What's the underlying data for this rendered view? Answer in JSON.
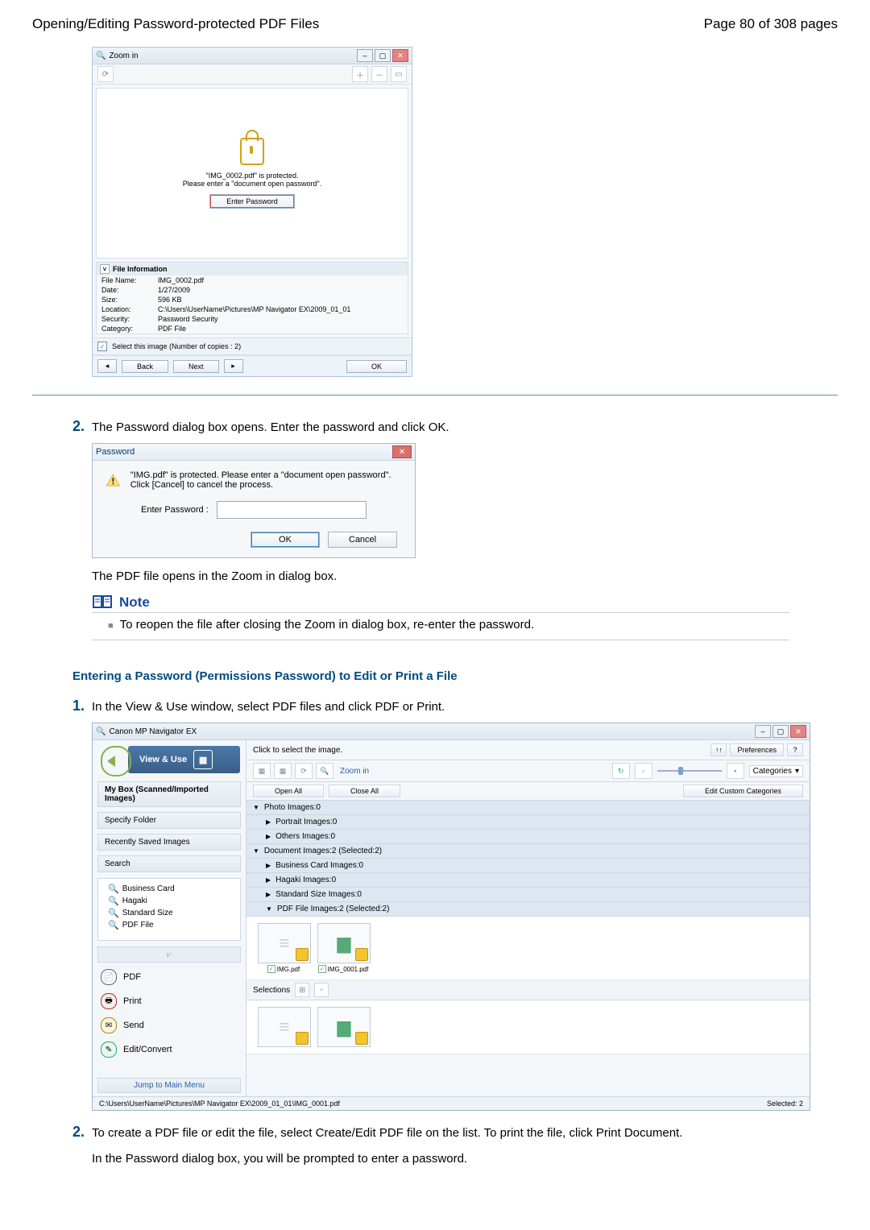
{
  "header": {
    "title": "Opening/Editing Password-protected PDF Files",
    "page_of": "Page 80 of 308 pages"
  },
  "zoom_window": {
    "title": "Zoom in",
    "protected_line1": "\"IMG_0002.pdf\" is protected.",
    "protected_line2": "Please enter a \"document open password\".",
    "enter_password_btn": "Enter Password",
    "file_info_title": "File Information",
    "rows": {
      "file_name_l": "File Name:",
      "file_name_v": "IMG_0002.pdf",
      "date_l": "Date:",
      "date_v": "1/27/2009",
      "size_l": "Size:",
      "size_v": "596 KB",
      "location_l": "Location:",
      "location_v": "C:\\Users\\UserName\\Pictures\\MP Navigator EX\\2009_01_01",
      "security_l": "Security:",
      "security_v": "Password Security",
      "category_l": "Category:",
      "category_v": "PDF File"
    },
    "select_image": "Select this image (Number of copies : 2)",
    "back": "Back",
    "next": "Next",
    "ok": "OK"
  },
  "step2a": {
    "num": "2.",
    "text": "The Password dialog box opens. Enter the password and click OK."
  },
  "pw_dialog": {
    "title": "Password",
    "msg": "\"IMG.pdf\" is protected. Please enter a \"document open password\". Click [Cancel] to cancel the process.",
    "label": "Enter Password :",
    "ok": "OK",
    "cancel": "Cancel"
  },
  "after_pw": "The PDF file opens in the Zoom in dialog box.",
  "note": {
    "label": "Note",
    "text": "To reopen the file after closing the Zoom in dialog box, re-enter the password."
  },
  "section2_title": "Entering a Password (Permissions Password) to Edit or Print a File",
  "step1b": {
    "num": "1.",
    "text": "In the View & Use window, select PDF files and click PDF or Print."
  },
  "mp": {
    "title": "Canon MP Navigator EX",
    "view_use": "View & Use",
    "breadcrumb": "Click to select the image.",
    "sort_icon_label": "↑↑",
    "preferences": "Preferences",
    "help": "?",
    "zoom_in": "Zoom in",
    "categories": "Categories",
    "open_all": "Open All",
    "close_all": "Close All",
    "edit_cats": "Edit Custom Categories",
    "side_items": {
      "a": "My Box (Scanned/Imported Images)",
      "b": "Specify Folder",
      "c": "Recently Saved Images",
      "d": "Search"
    },
    "tags": {
      "a": "Business Card",
      "b": "Hagaki",
      "c": "Standard Size",
      "d": "PDF File"
    },
    "actions": {
      "pdf": "PDF",
      "print": "Print",
      "send": "Send",
      "edit": "Edit/Convert"
    },
    "jump": "Jump to Main Menu",
    "cats": {
      "photo": "Photo   Images:0",
      "portrait": "Portrait   Images:0",
      "others": "Others   Images:0",
      "document": "Document   Images:2   (Selected:2)",
      "bcard": "Business Card   Images:0",
      "hagaki": "Hagaki   Images:0",
      "std": "Standard Size   Images:0",
      "pdffile": "PDF File   Images:2   (Selected:2)"
    },
    "thumbs": {
      "a": "IMG.pdf",
      "b": "IMG_0001.pdf"
    },
    "selections": "Selections",
    "status_path": "C:\\Users\\UserName\\Pictures\\MP Navigator EX\\2009_01_01\\IMG_0001.pdf",
    "status_sel": "Selected: 2"
  },
  "step2b": {
    "num": "2.",
    "text1": "To create a PDF file or edit the file, select Create/Edit PDF file on the list. To print the file, click Print Document.",
    "text2": "In the Password dialog box, you will be prompted to enter a password."
  }
}
